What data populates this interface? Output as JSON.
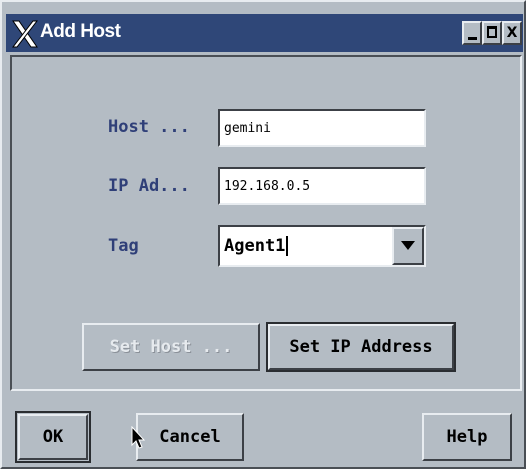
{
  "window": {
    "title": "Add Host",
    "minimize_glyph": "_",
    "close_glyph": "X"
  },
  "form": {
    "host_label": "Host ...",
    "host_value": "gemini",
    "ip_label": "IP Ad...",
    "ip_value": "192.168.0.5",
    "tag_label": "Tag",
    "tag_value": "Agent1"
  },
  "actions": {
    "set_host_label": "Set Host ...",
    "set_ip_label": "Set IP Address"
  },
  "footer": {
    "ok_label": "OK",
    "cancel_label": "Cancel",
    "help_label": "Help"
  },
  "colors": {
    "titlebar": "#2f4778",
    "surface": "#b4bcc4",
    "label_text": "#2f3f78"
  },
  "icons": {
    "title_logo": "x-window-logo-icon",
    "dropdown": "chevron-down-icon",
    "pointer": "mouse-pointer-icon"
  }
}
